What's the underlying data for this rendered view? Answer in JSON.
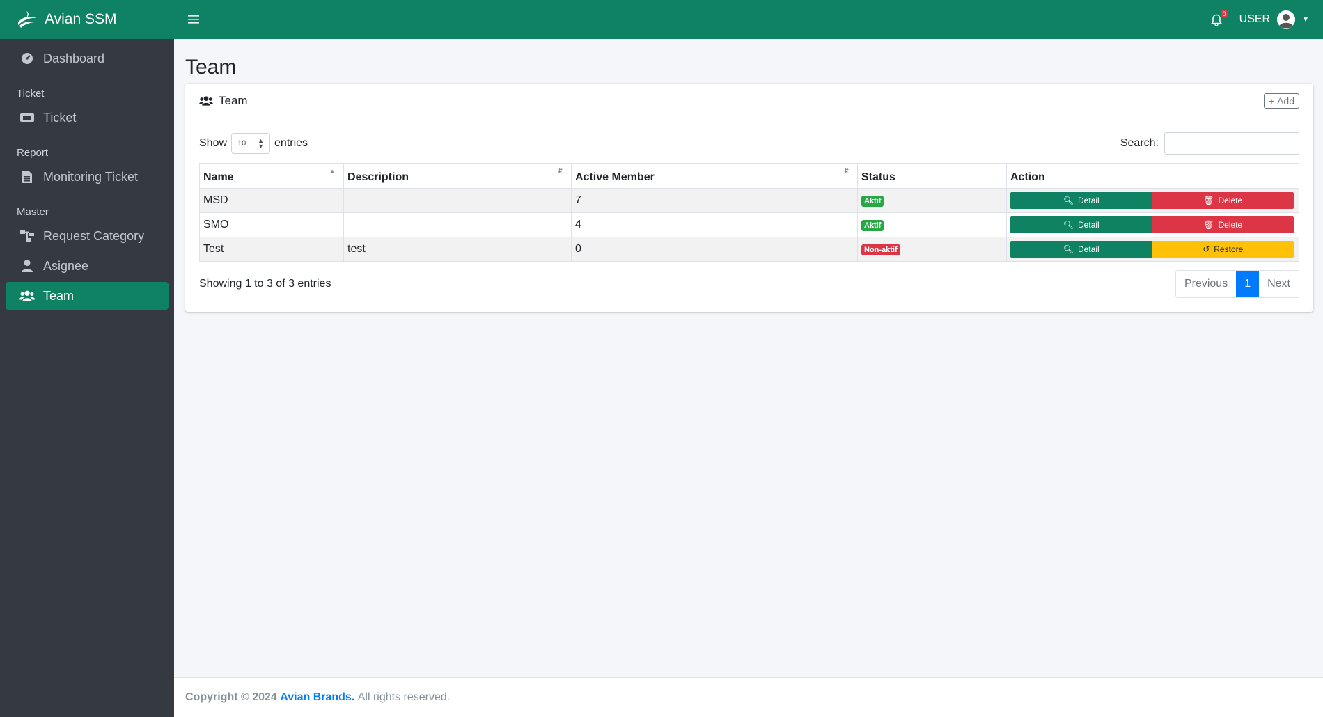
{
  "brand": {
    "name": "Avian SSM"
  },
  "sidebar": {
    "items": [
      {
        "label": "Dashboard",
        "icon": "gauge-icon"
      },
      {
        "header": "Ticket"
      },
      {
        "label": "Ticket",
        "icon": "ticket-icon"
      },
      {
        "header": "Report"
      },
      {
        "label": "Monitoring Ticket",
        "icon": "document-icon"
      },
      {
        "header": "Master"
      },
      {
        "label": "Request Category",
        "icon": "sitemap-icon"
      },
      {
        "label": "Asignee",
        "icon": "user-icon"
      },
      {
        "label": "Team",
        "icon": "users-icon",
        "active": true
      }
    ]
  },
  "topbar": {
    "notification_count": "0",
    "user_label": "USER"
  },
  "page": {
    "title": "Team"
  },
  "card": {
    "title": "Team",
    "add_label": "Add"
  },
  "table_controls": {
    "show_label": "Show",
    "entries_value": "10",
    "entries_label": "entries",
    "search_label": "Search:",
    "search_value": ""
  },
  "table": {
    "columns": [
      "Name",
      "Description",
      "Active Member",
      "Status",
      "Action"
    ],
    "rows": [
      {
        "name": "MSD",
        "description": "",
        "active_member": "7",
        "status": "Aktif",
        "status_color": "#28a745",
        "detail": "Detail",
        "second_action": "Delete"
      },
      {
        "name": "SMO",
        "description": "",
        "active_member": "4",
        "status": "Aktif",
        "status_color": "#28a745",
        "detail": "Detail",
        "second_action": "Delete"
      },
      {
        "name": "Test",
        "description": "test",
        "active_member": "0",
        "status": "Non-aktif",
        "status_color": "#dc3545",
        "detail": "Detail",
        "second_action": "Restore"
      }
    ]
  },
  "pagination": {
    "info": "Showing 1 to 3 of 3 entries",
    "previous": "Previous",
    "current": "1",
    "next": "Next"
  },
  "footer": {
    "copyright": "Copyright © 2024",
    "company": "Avian Brands.",
    "rights": "All rights reserved."
  },
  "colors": {
    "primary": "#0e8263",
    "sidebar": "#343a40",
    "danger": "#dc3545",
    "warning": "#ffc107",
    "link": "#007bff"
  }
}
